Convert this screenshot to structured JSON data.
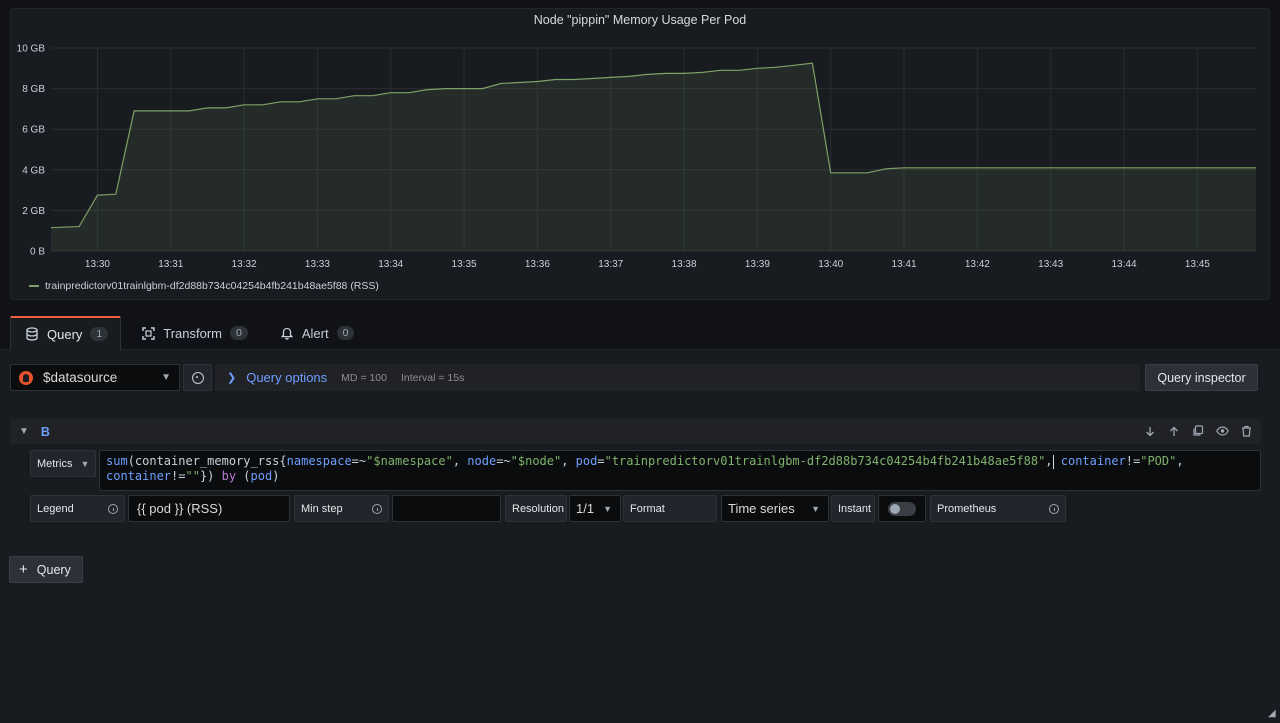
{
  "panel": {
    "title": "Node \"pippin\" Memory Usage Per Pod",
    "legend_label": "trainpredictorv01trainlgbm-df2d88b734c04254b4fb241b48ae5f88 (RSS)"
  },
  "chart_data": {
    "type": "area",
    "title": "Node \"pippin\" Memory Usage Per Pod",
    "x_ticks": [
      "13:30",
      "13:31",
      "13:32",
      "13:33",
      "13:34",
      "13:35",
      "13:36",
      "13:37",
      "13:38",
      "13:39",
      "13:40",
      "13:41",
      "13:42",
      "13:43",
      "13:44",
      "13:45"
    ],
    "y_ticks": [
      "0 B",
      "2 GB",
      "4 GB",
      "6 GB",
      "8 GB",
      "10 GB"
    ],
    "ylim": [
      0,
      10
    ],
    "xlim": [
      "13:29:22",
      "13:45:48"
    ],
    "grid": true,
    "legend_position": "bottom-left",
    "series": [
      {
        "name": "trainpredictorv01trainlgbm-df2d88b734c04254b4fb241b48ae5f88 (RSS)",
        "color": "#7ea167",
        "x": [
          "13:29:22",
          "13:29:45",
          "13:30:00",
          "13:30:15",
          "13:30:30",
          "13:30:45",
          "13:31:00",
          "13:31:15",
          "13:31:30",
          "13:31:45",
          "13:32:00",
          "13:32:15",
          "13:32:30",
          "13:32:45",
          "13:33:00",
          "13:33:15",
          "13:33:30",
          "13:33:45",
          "13:34:00",
          "13:34:15",
          "13:34:30",
          "13:34:45",
          "13:35:00",
          "13:35:15",
          "13:35:30",
          "13:35:45",
          "13:36:00",
          "13:36:15",
          "13:36:30",
          "13:36:45",
          "13:37:00",
          "13:37:15",
          "13:37:30",
          "13:37:45",
          "13:38:00",
          "13:38:15",
          "13:38:30",
          "13:38:45",
          "13:39:00",
          "13:39:15",
          "13:39:30",
          "13:39:45",
          "13:40:00",
          "13:40:30",
          "13:40:45",
          "13:41:00",
          "13:45:48"
        ],
        "values": [
          1.15,
          1.2,
          2.75,
          2.8,
          6.9,
          6.9,
          6.9,
          6.9,
          7.05,
          7.05,
          7.2,
          7.2,
          7.35,
          7.35,
          7.5,
          7.5,
          7.65,
          7.65,
          7.8,
          7.8,
          7.95,
          8.0,
          8.0,
          8.0,
          8.25,
          8.3,
          8.35,
          8.45,
          8.45,
          8.5,
          8.55,
          8.6,
          8.7,
          8.75,
          8.75,
          8.8,
          8.9,
          8.9,
          9.0,
          9.05,
          9.15,
          9.25,
          3.85,
          3.85,
          4.05,
          4.1,
          4.1
        ]
      }
    ]
  },
  "tabs": [
    {
      "label": "Query",
      "count": "1",
      "icon": "database-icon"
    },
    {
      "label": "Transform",
      "count": "0",
      "icon": "transform-icon"
    },
    {
      "label": "Alert",
      "count": "0",
      "icon": "bell-icon"
    }
  ],
  "query_row": {
    "datasource": "$datasource",
    "options_label": "Query options",
    "md": "MD = 100",
    "interval": "Interval = 15s",
    "inspector_label": "Query inspector"
  },
  "query_b": {
    "name": "B",
    "metrics_label": "Metrics",
    "expr": {
      "t1": "sum",
      "t2": "(container_memory_rss{",
      "t3": "namespace",
      "t4": "=~",
      "t5": "\"$namespace\"",
      "t6": ", ",
      "t7": "node",
      "t8": "=~",
      "t9": "\"$node\"",
      "t10": ", ",
      "t11": "pod",
      "t12": "=",
      "t13": "\"trainpredictorv01trainlgbm-df2d88b734c04254b4fb241b48ae5f88\"",
      "t14": ",",
      "t15": " container",
      "t16": "!=",
      "t17": "\"POD\"",
      "t18": ",",
      "t19": "container",
      "t20": "!=",
      "t21": "\"\"",
      "t22": "}) ",
      "t23": "by",
      "t24": " (",
      "t25": "pod",
      "t26": ")"
    },
    "legend_label": "Legend",
    "legend_value": "{{ pod }} (RSS)",
    "min_step_label": "Min step",
    "min_step_value": "",
    "resolution_label": "Resolution",
    "resolution_value": "1/1",
    "format_label": "Format",
    "format_value": "Time series",
    "instant_label": "Instant",
    "prometheus_label": "Prometheus"
  },
  "add_query_label": "Query"
}
